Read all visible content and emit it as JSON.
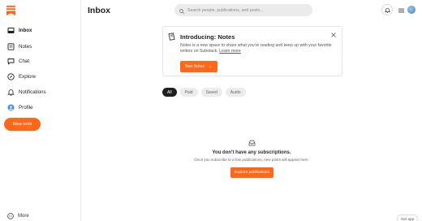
{
  "sidebar": {
    "items": [
      {
        "label": "Inbox",
        "icon": "inbox-icon",
        "active": true
      },
      {
        "label": "Notes",
        "icon": "notes-icon"
      },
      {
        "label": "Chat",
        "icon": "chat-icon"
      },
      {
        "label": "Explore",
        "icon": "compass-icon"
      },
      {
        "label": "Notifications",
        "icon": "bell-icon"
      },
      {
        "label": "Profile",
        "icon": "avatar-icon"
      }
    ],
    "new_note_label": "New note",
    "more_label": "More"
  },
  "header": {
    "title": "Inbox",
    "search_placeholder": "Search people, publications, and posts..."
  },
  "notes_card": {
    "title": "Introducing: Notes",
    "description": "Notes is a new space to share what you're reading and keep up with your favorite writers on Substack.",
    "learn_more": "Learn more",
    "button_label": "See Notes"
  },
  "filters": [
    {
      "label": "All",
      "active": true
    },
    {
      "label": "Paid"
    },
    {
      "label": "Saved"
    },
    {
      "label": "Audio"
    }
  ],
  "empty_state": {
    "title": "You don't have any subscriptions.",
    "description": "Once you subscribe to a few publications, new posts will appear here.",
    "button_label": "Explore publications"
  },
  "get_app_label": "Get app",
  "colors": {
    "accent": "#ff6719",
    "text": "#1f1f1f",
    "pill_bg": "#ececec"
  }
}
